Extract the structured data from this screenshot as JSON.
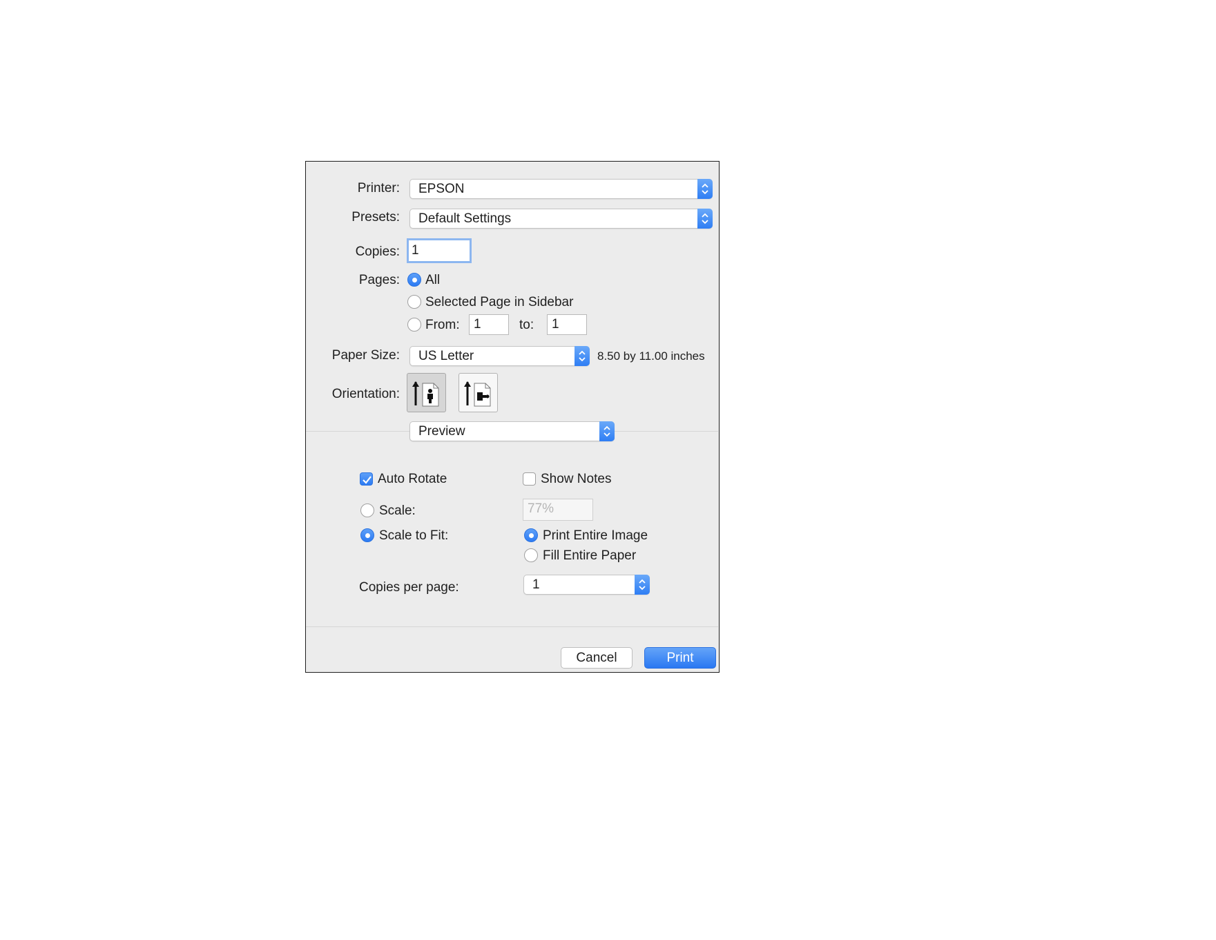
{
  "printer": {
    "label": "Printer:",
    "value": "EPSON"
  },
  "presets": {
    "label": "Presets:",
    "value": "Default Settings"
  },
  "copies": {
    "label": "Copies:",
    "value": "1"
  },
  "pages": {
    "label": "Pages:",
    "all_label": "All",
    "selected_label": "Selected Page in Sidebar",
    "from_label": "From:",
    "from_value": "1",
    "to_label": "to:",
    "to_value": "1",
    "selected_option": "All"
  },
  "paper_size": {
    "label": "Paper Size:",
    "value": "US Letter",
    "dimensions": "8.50 by 11.00 inches"
  },
  "orientation": {
    "label": "Orientation:",
    "selected": "portrait"
  },
  "section_popup": {
    "value": "Preview"
  },
  "preview": {
    "auto_rotate_label": "Auto Rotate",
    "auto_rotate_checked": true,
    "show_notes_label": "Show Notes",
    "show_notes_checked": false,
    "scale_label": "Scale:",
    "scale_value": "77%",
    "scale_to_fit_label": "Scale to Fit:",
    "scale_mode": "Scale to Fit",
    "print_entire_image_label": "Print Entire Image",
    "fill_entire_paper_label": "Fill Entire Paper",
    "fit_mode": "Print Entire Image",
    "copies_per_page_label": "Copies per page:",
    "copies_per_page_value": "1"
  },
  "buttons": {
    "cancel": "Cancel",
    "print": "Print"
  },
  "colors": {
    "accent": "#2f7ef4",
    "dialog_bg": "#ececec"
  }
}
